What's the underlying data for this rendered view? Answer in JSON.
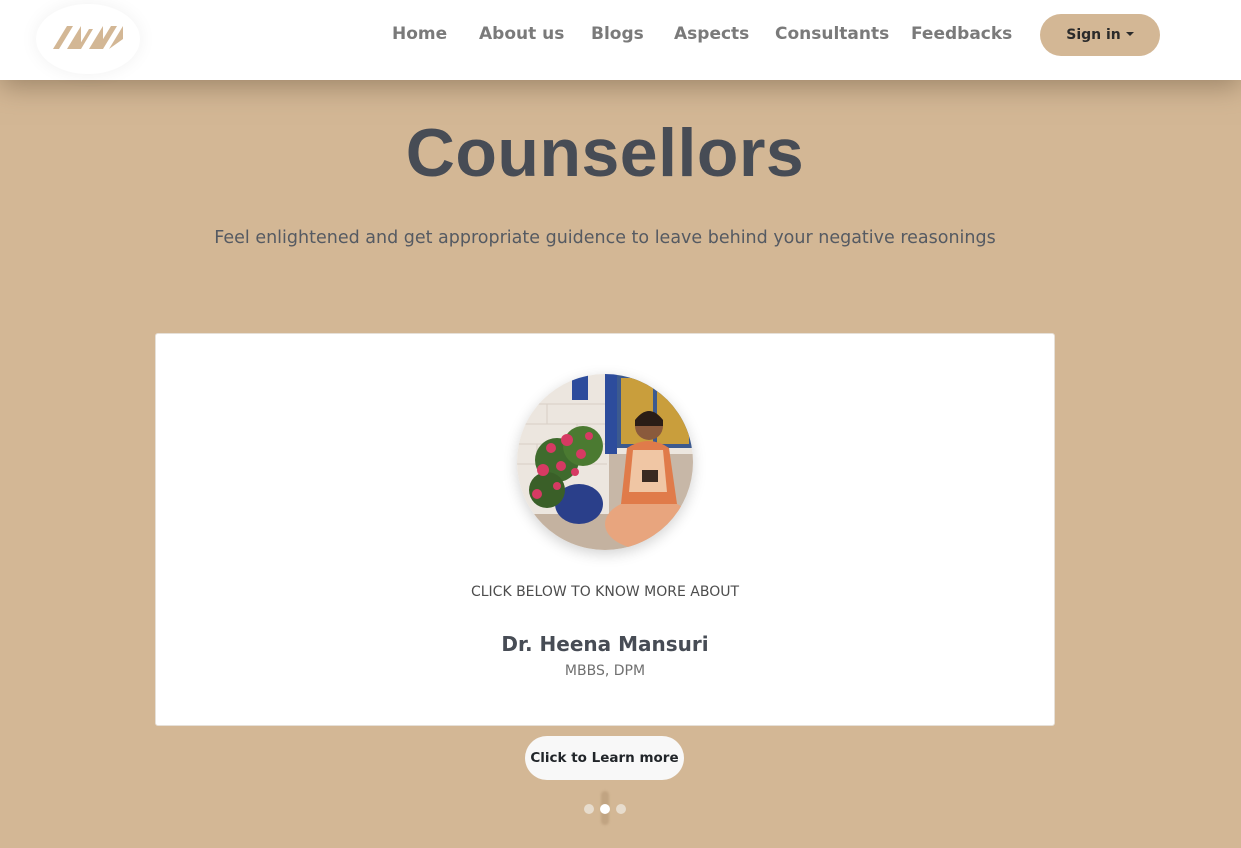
{
  "brand": {
    "logo_icon": "brand-logo-icon",
    "color": "#d3b795"
  },
  "nav": {
    "items": [
      {
        "label": "Home"
      },
      {
        "label": "About us"
      },
      {
        "label": "Blogs"
      },
      {
        "label": "Aspects"
      },
      {
        "label": "Consultants"
      },
      {
        "label": "Feedbacks"
      }
    ],
    "signin_label": "Sign in",
    "signin_icon": "caret-down-icon"
  },
  "hero": {
    "title": "Counsellors",
    "subtitle": "Feel enlightened and get appropriate guidence to leave behind your negative reasonings"
  },
  "card": {
    "avatar_icon": "counsellor-photo",
    "caption": "CLICK BELOW TO KNOW MORE ABOUT",
    "name": "Dr. Heena Mansuri",
    "degree": "MBBS, DPM"
  },
  "cta": {
    "label": "Click to Learn more"
  },
  "carousel": {
    "slide_count": 3,
    "active_index": 1
  },
  "colors": {
    "background": "#d3b795",
    "title": "#474c55",
    "nav_text": "#7a7a7a",
    "card": "#ffffff"
  }
}
